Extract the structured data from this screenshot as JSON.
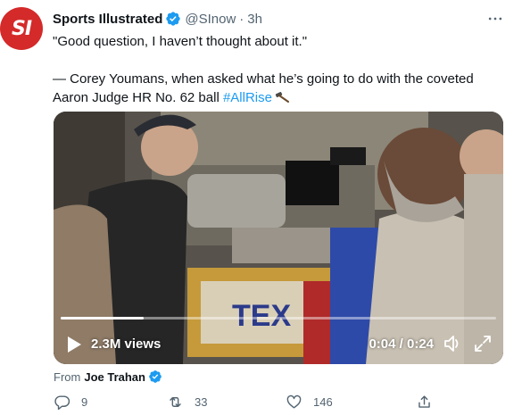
{
  "tweet": {
    "avatar_text": "SI",
    "display_name": "Sports Illustrated",
    "handle": "@SInow",
    "separator": "·",
    "timestamp": "3h",
    "quote_line": "\"Good question, I haven’t thought about it.\"",
    "attribution_line": "— Corey Youmans, when asked what he’s going to do with the coveted Aaron Judge HR No. 62 ball",
    "hashtag": "#AllRise",
    "hashtag_emoji": "hammer-icon"
  },
  "video": {
    "views_label": "2.3M views",
    "time_label": "0:04 / 0:24",
    "progress": 0.19,
    "scene_banner_text": "TEX"
  },
  "source": {
    "prefix": "From",
    "name": "Joe Trahan"
  },
  "actions": {
    "replies": "9",
    "retweets": "33",
    "likes": "146"
  },
  "colors": {
    "accent": "#1d9bf0",
    "brand": "#d42a2a",
    "secondary_text": "#536471"
  }
}
